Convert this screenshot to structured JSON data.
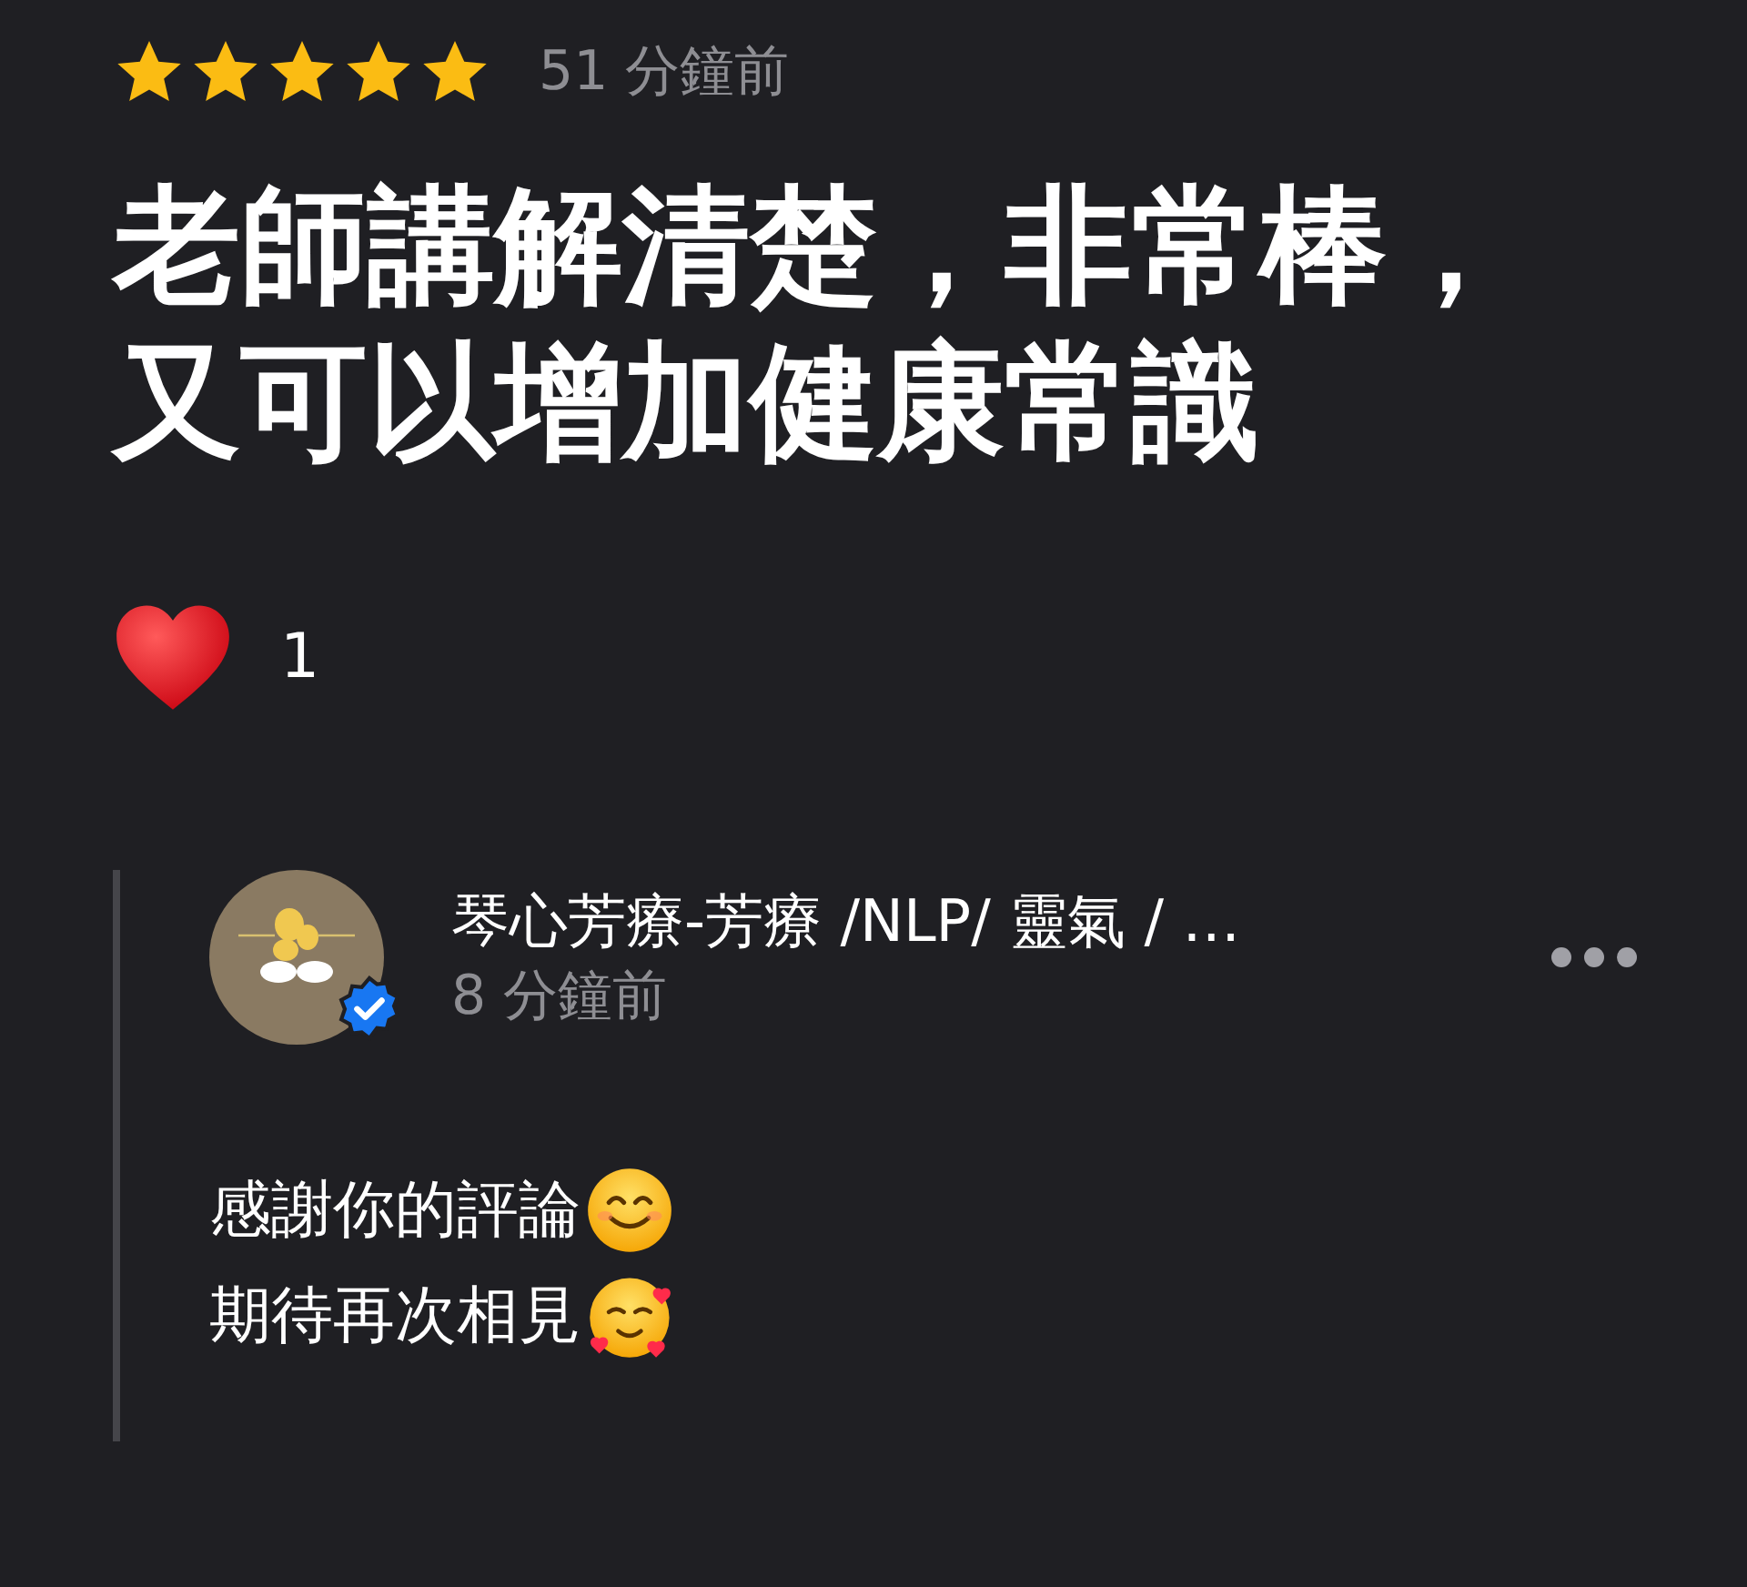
{
  "review": {
    "stars": 5,
    "time": "51 分鐘前",
    "text_lines": [
      "老師講解清楚，非常棒，",
      "又可以增加健康常識"
    ],
    "reaction": {
      "count": "1"
    }
  },
  "reply": {
    "author": "琴心芳療-芳療 /NLP/ 靈氣 / …",
    "verified": true,
    "time": "8 分鐘前",
    "lines": [
      "感謝你的評論",
      "期待再次相見"
    ]
  }
}
